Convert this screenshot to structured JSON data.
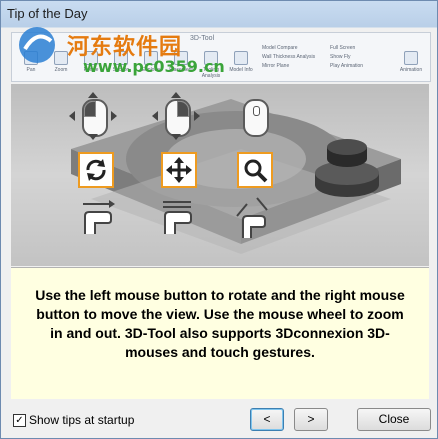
{
  "window": {
    "title": "Tip of the Day"
  },
  "watermark": {
    "title": "河东软件园",
    "url": "www.pc0359.cn"
  },
  "ribbon": {
    "title": "3D-Tool",
    "items": [
      "Pan",
      "Zoom",
      "Rotate",
      "Section",
      "Explode",
      "Placement",
      "Tooling Analysis",
      "Model Info",
      "Animation"
    ],
    "side_items": [
      "Model Compare",
      "Wall Thickness Analysis",
      "Mirror Plane",
      "Full Screen",
      "Show Fly",
      "Play Animation"
    ]
  },
  "stage": {
    "icons": [
      {
        "mouse_button": "left",
        "action": "rotate-icon",
        "gesture": "one-finger-swipe"
      },
      {
        "mouse_button": "right",
        "action": "move-icon",
        "gesture": "two-finger-swipe"
      },
      {
        "mouse_button": "wheel",
        "action": "zoom-icon",
        "gesture": "pinch"
      }
    ],
    "accent": "#ee9b20"
  },
  "tip": {
    "text": "Use the left mouse button to rotate and the right mouse button to move the view. Use the mouse wheel to zoom in and out. 3D-Tool also supports 3Dconnexion 3D-mouses and touch gestures."
  },
  "footer": {
    "show_tips_checked": true,
    "show_tips_label": "Show tips at startup",
    "prev_label": "<",
    "next_label": ">",
    "close_label": "Close"
  }
}
